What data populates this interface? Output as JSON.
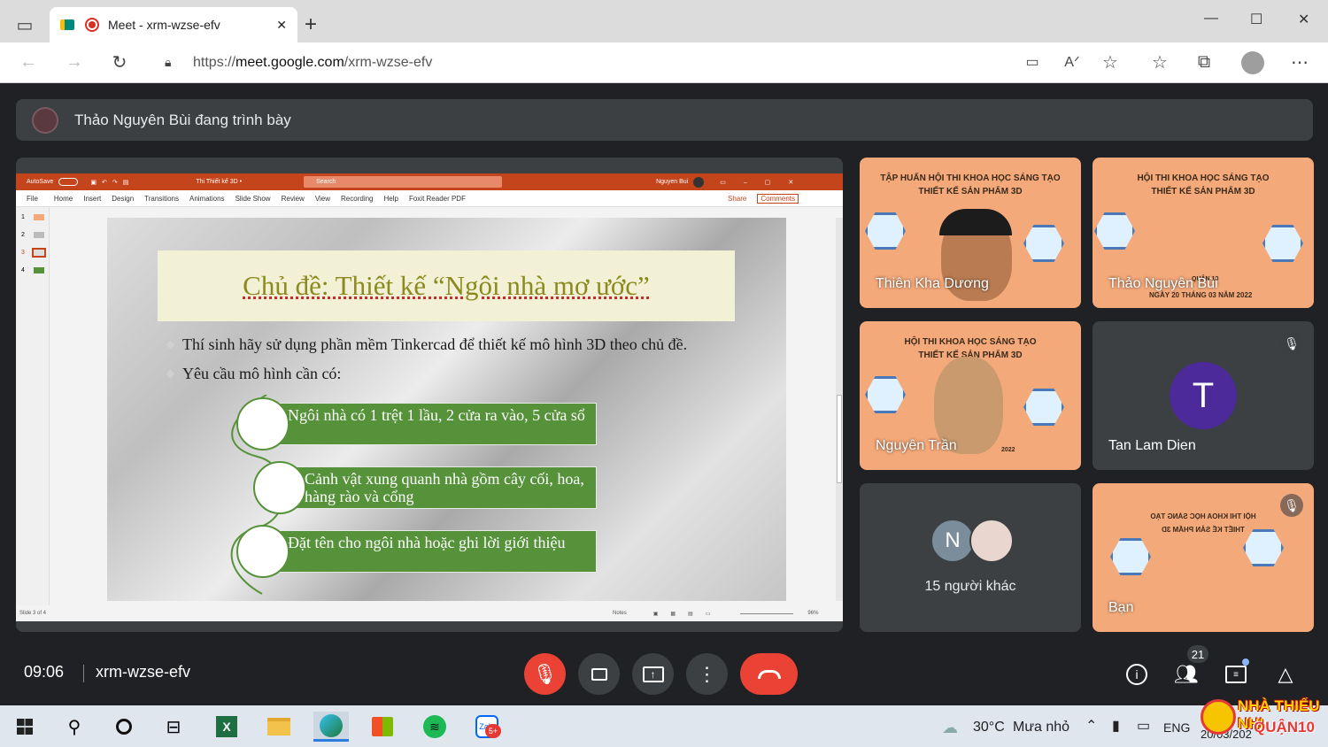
{
  "browser": {
    "tab_title": "Meet - xrm-wzse-efv",
    "new_tab": "+",
    "url_scheme": "https://",
    "url_host": "meet.google.com",
    "url_path": "/xrm-wzse-efv",
    "window_controls": {
      "minimize": "—",
      "maximize": "☐",
      "close": "✕"
    }
  },
  "banner": {
    "presenter_text": "Thảo Nguyên Bùi đang trình bày"
  },
  "powerpoint": {
    "title_left": "AutoSave",
    "file_name": "Thi Thiết kế 3D  •",
    "search": "Search",
    "user": "Nguyen Bui",
    "menu": [
      "File",
      "Home",
      "Insert",
      "Design",
      "Transitions",
      "Animations",
      "Slide Show",
      "Review",
      "View",
      "Recording",
      "Help",
      "Foxit Reader PDF"
    ],
    "share": "Share",
    "comments": "Comments",
    "thumbs": [
      "1",
      "2",
      "3",
      "4"
    ],
    "status_left": "Slide 3 of 4",
    "status_notes": "Notes",
    "zoom": "96%"
  },
  "slide": {
    "title": "Chủ đề: Thiết kế “Ngôi nhà mơ ước”",
    "bullets": [
      "Thí sinh hãy sử dụng phần mềm Tinkercad để thiết kế mô hình 3D theo chủ đề.",
      "Yêu cầu mô hình cần có:"
    ],
    "requirements": [
      "Ngôi nhà có 1 trệt 1 lầu, 2 cửa ra vào, 5 cửa sổ",
      "Cảnh vật xung quanh nhà gồm cây cối, hoa, hàng rào và cổng",
      "Đặt tên cho ngôi nhà hoặc ghi lời giới thiệu"
    ]
  },
  "participants": [
    {
      "name": "Thiên Kha Dương",
      "poster": [
        "TẬP HUẤN HỘI THI KHOA HỌC SÁNG TẠO",
        "THIẾT KẾ SẢN PHẨM 3D"
      ]
    },
    {
      "name": "Thảo Nguyên Bùi",
      "poster": [
        "HỘI THI KHOA HỌC SÁNG TẠO",
        "THIẾT KẾ SẢN PHẨM 3D"
      ],
      "sub": "QUẬN 10",
      "date": "NGÀY 20 THÁNG 03 NĂM 2022"
    },
    {
      "name": "Nguyên Trần",
      "poster": [
        "HỘI THI KHOA HỌC SÁNG TẠO",
        "THIẾT KẾ SẢN PHẨM 3D"
      ],
      "date": "2022"
    },
    {
      "name": "Tan Lam Dien",
      "initial": "T",
      "color": "#4c2a99"
    },
    {
      "others_text": "15 người khác",
      "initial": "N"
    },
    {
      "name": "Bạn",
      "poster": [
        "HỘI THI KHOA HỌC SÁNG TẠO",
        "THIẾT KẾ SẢN PHẨM 3D"
      ]
    }
  ],
  "meeting": {
    "time": "09:06",
    "code": "xrm-wzse-efv",
    "people_count": "21",
    "end_color": "#ea4335"
  },
  "taskbar": {
    "weather_temp": "30°C",
    "weather_text": "Mưa nhỏ",
    "lang": "ENG",
    "date_partial": "20/03/202",
    "watermark_top": "NHÀ THIẾU NHI",
    "watermark_bottom": "QUẬN10"
  }
}
